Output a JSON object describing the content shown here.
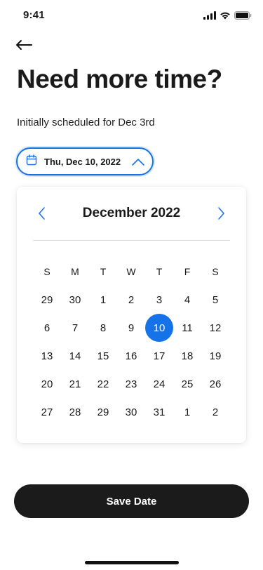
{
  "status_bar": {
    "time": "9:41",
    "icons": [
      "signal-icon",
      "wifi-icon",
      "battery-icon"
    ]
  },
  "header": {
    "back_icon": "arrow-left-icon",
    "title": "Need more time?",
    "subtitle": "Initially scheduled for Dec 3rd"
  },
  "date_picker": {
    "selected_label": "Thu, Dec 10, 2022",
    "calendar_icon": "calendar-icon",
    "toggle_icon": "chevron-up-icon",
    "accent_color": "#1672e8"
  },
  "calendar": {
    "month_label": "December 2022",
    "prev_icon": "chevron-left-icon",
    "next_icon": "chevron-right-icon",
    "weekdays": [
      "S",
      "M",
      "T",
      "W",
      "T",
      "F",
      "S"
    ],
    "days": [
      "29",
      "30",
      "1",
      "2",
      "3",
      "4",
      "5",
      "6",
      "7",
      "8",
      "9",
      "10",
      "11",
      "12",
      "13",
      "14",
      "15",
      "16",
      "17",
      "18",
      "19",
      "20",
      "21",
      "22",
      "23",
      "24",
      "25",
      "26",
      "27",
      "28",
      "29",
      "30",
      "31",
      "1",
      "2"
    ],
    "selected_index": 11
  },
  "footer": {
    "save_label": "Save Date",
    "button_color": "#1b1b1b"
  }
}
